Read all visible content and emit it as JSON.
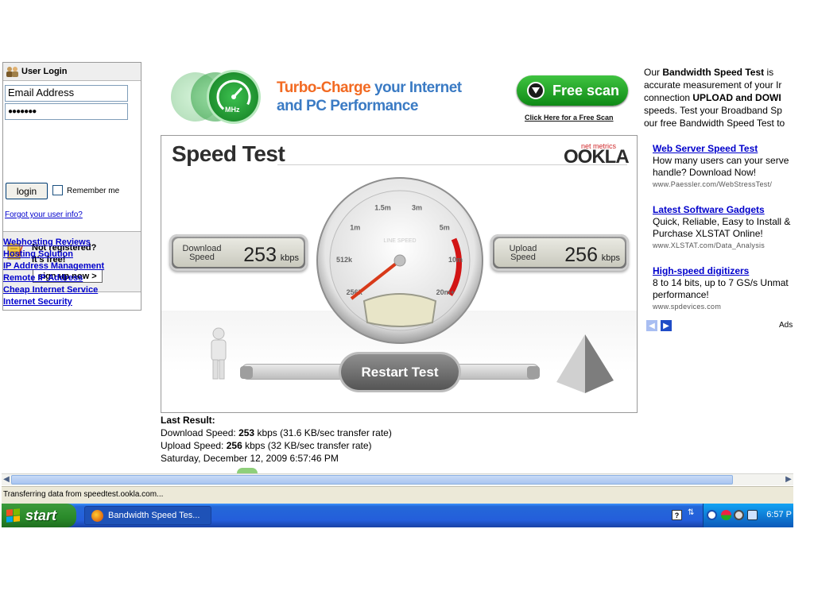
{
  "login": {
    "title": "User Login",
    "email_value": "Email Address",
    "password_value": "●●●●●●●",
    "login_label": "login",
    "remember_label": "Remember me",
    "forgot_label": "Forgot your user info?",
    "not_registered": "Not registered?",
    "free": "It's free!",
    "signup_label": "sign up now >",
    "links": [
      "Webhosting Reviews",
      "Hosting Solution",
      "IP Address Management",
      "Remote IP Address",
      "Cheap Internet Service",
      "Internet Security"
    ]
  },
  "banner": {
    "mhz_label": "MHz",
    "headline_orange": "Turbo-Charge",
    "headline_rest": " your Internet",
    "headline_line2": "and PC Performance",
    "freescan_label": "Free scan",
    "freescan_sub": "Click Here for a Free Scan"
  },
  "speedtest": {
    "title": "Speed Test",
    "brand_top": "net metrics",
    "brand": "OOKLA",
    "download_label_1": "Download",
    "download_label_2": "Speed",
    "download_value": "253",
    "download_unit": "kbps",
    "upload_label_1": "Upload",
    "upload_label_2": "Speed",
    "upload_value": "256",
    "upload_unit": "kbps",
    "restart_label": "Restart Test",
    "dial_ticks": [
      "256k",
      "512k",
      "1m",
      "1.5m",
      "3m",
      "5m",
      "10m",
      "20m+"
    ]
  },
  "result": {
    "heading": "Last Result:",
    "download_prefix": "Download Speed: ",
    "download_value": "253",
    "download_suffix": " kbps (31.6 KB/sec transfer rate)",
    "upload_prefix": "Upload Speed: ",
    "upload_value": "256",
    "upload_suffix": " kbps (32 KB/sec transfer rate)",
    "timestamp": "Saturday, December 12, 2009 6:57:46 PM"
  },
  "right": {
    "intro_l1a": "Our ",
    "intro_l1b": "Bandwidth Speed Test",
    "intro_l1c": " is",
    "intro_l2": "accurate measurement of your Ir",
    "intro_l3a": "connection ",
    "intro_l3b": "UPLOAD and DOWI",
    "intro_l4": "speeds. Test your Broadband Sp",
    "intro_l5": "our free Bandwidth Speed Test to",
    "ads": [
      {
        "title": "Web Server Speed Test",
        "desc1": "How many users can your serve",
        "desc2": "handle? Download Now!",
        "url": "www.Paessler.com/WebStressTest/"
      },
      {
        "title": "Latest Software Gadgets",
        "desc1": "Quick, Reliable, Easy to Install &",
        "desc2": "Purchase XLSTAT Online!",
        "url": "www.XLSTAT.com/Data_Analysis"
      },
      {
        "title": "High-speed digitizers",
        "desc1": "8 to 14 bits, up to 7 GS/s Unmat",
        "desc2": "performance!",
        "url": "www.spdevices.com"
      }
    ],
    "ads_label": "Ads"
  },
  "status_text": "Transferring data from speedtest.ookla.com...",
  "taskbar": {
    "start_label": "start",
    "task_label": "Bandwidth Speed Tes...",
    "clock": "6:57 P"
  },
  "colors": {
    "link": "#0000cc",
    "banner_blue": "#3b7bc4",
    "banner_orange": "#f26a22",
    "freescan_green": "#1ea526",
    "taskbar_blue": "#245edb",
    "start_green": "#2a8a2a"
  }
}
